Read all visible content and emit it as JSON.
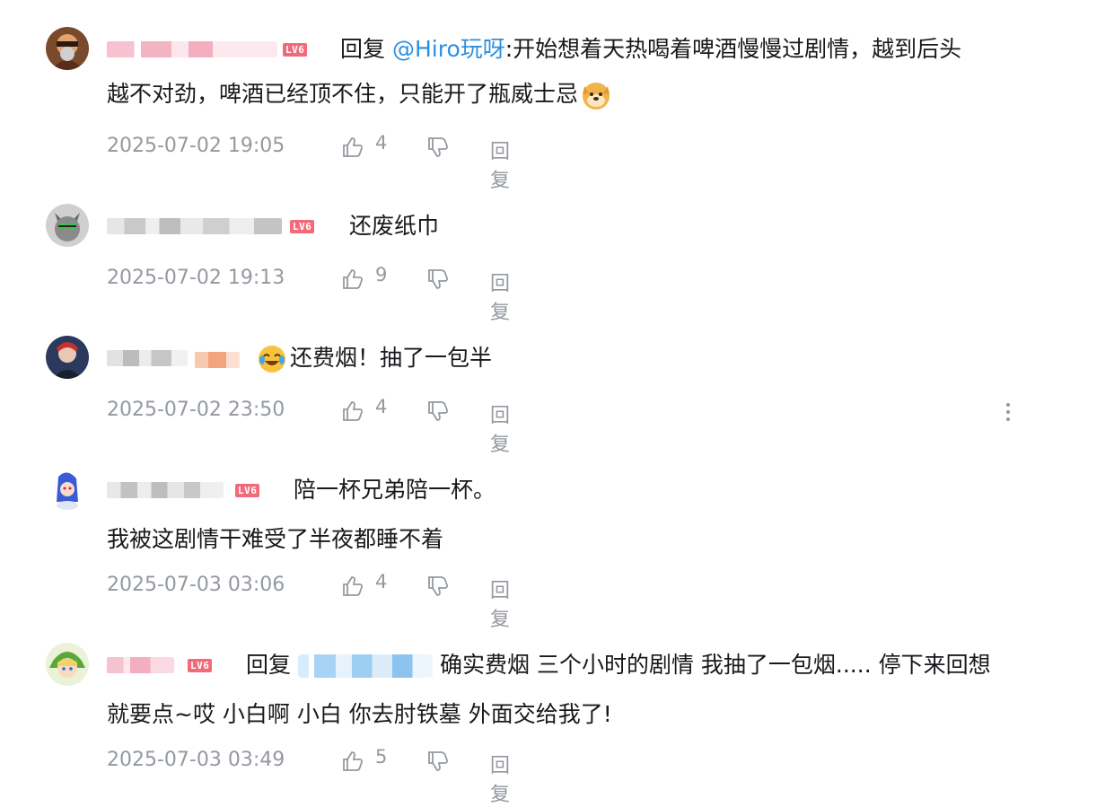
{
  "comments": [
    {
      "reply_prefix": "回复",
      "mention": "@Hiro玩呀",
      "text_line1": ":开始想着天热喝着啤酒慢慢过剧情，越到后头",
      "text_line2": "越不对劲，啤酒已经顶不住，只能开了瓶威士忌",
      "level": "LV6",
      "time": "2025-07-02 19:05",
      "likes": "4",
      "reply_label": "回复"
    },
    {
      "text_line1": "还废纸巾",
      "level": "LV6",
      "time": "2025-07-02 19:13",
      "likes": "9",
      "reply_label": "回复"
    },
    {
      "text_line1": "还费烟！抽了一包半",
      "time": "2025-07-02 23:50",
      "likes": "4",
      "reply_label": "回复"
    },
    {
      "text_line1": "陪一杯兄弟陪一杯。",
      "text_line2": "我被这剧情干难受了半夜都睡不着",
      "level": "LV6",
      "time": "2025-07-03 03:06",
      "likes": "4",
      "reply_label": "回复"
    },
    {
      "reply_prefix": "回复",
      "text_line1": "确实费烟 三个小时的剧情 我抽了一包烟..... 停下来回想",
      "text_line2": "就要点~哎 小白啊 小白 你去肘铁墓 外面交给我了!",
      "level": "LV6",
      "time": "2025-07-03 03:49",
      "likes": "5",
      "reply_label": "回复"
    }
  ],
  "icons": {
    "like": "thumbs-up-icon",
    "dislike": "thumbs-down-icon",
    "more": "more-vertical-icon",
    "emoji_doge": "doge-emoji-icon",
    "emoji_laugh": "laugh-cry-emoji-icon"
  },
  "colors": {
    "mention": "#2f8fdf",
    "meta": "#9499a0",
    "level_badge": "#f06a7a",
    "text": "#18191c"
  }
}
